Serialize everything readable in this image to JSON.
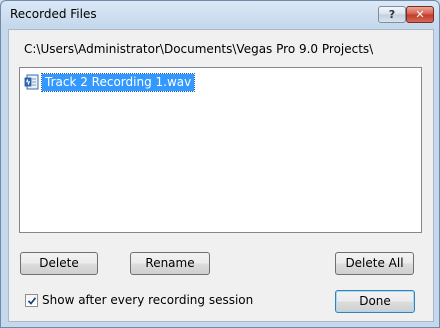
{
  "window": {
    "title": "Recorded Files",
    "help_label": "?",
    "close_label": "✕"
  },
  "path": "C:\\Users\\Administrator\\Documents\\Vegas Pro 9.0 Projects\\",
  "files": [
    {
      "name": "Track 2 Recording 1.wav",
      "selected": true
    }
  ],
  "buttons": {
    "delete": "Delete",
    "rename": "Rename",
    "delete_all": "Delete All",
    "done": "Done"
  },
  "checkbox": {
    "label": "Show after every recording session",
    "checked": true
  }
}
